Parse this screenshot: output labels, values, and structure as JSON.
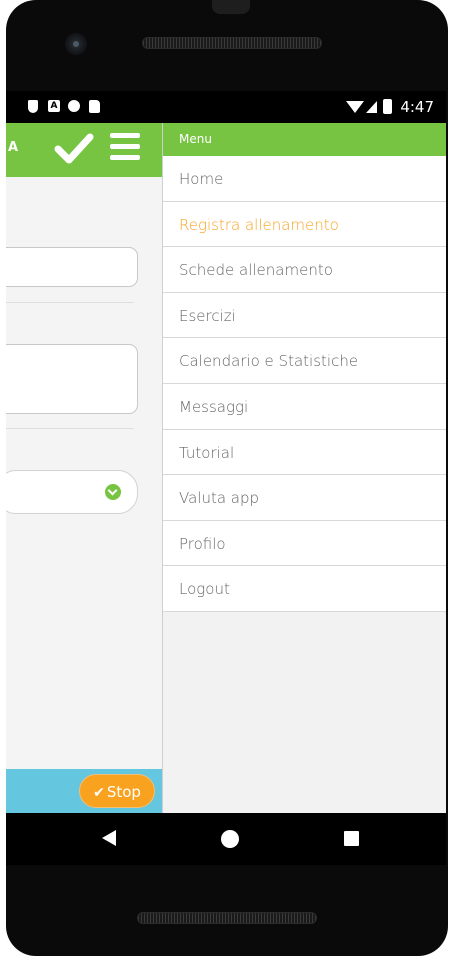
{
  "status_bar": {
    "left_icons": [
      "shield-icon",
      "a-icon",
      "record-icon",
      "sd-card-icon"
    ],
    "right_icons": [
      "wifi-icon",
      "signal-icon",
      "battery-charging-icon"
    ],
    "time": "4:47"
  },
  "app_bar": {
    "title_fragment": "A",
    "icons": [
      "checkmark-icon",
      "hamburger-menu-icon"
    ],
    "color": "#76c442"
  },
  "form": {
    "select_icon": "chevron-down-circle-icon"
  },
  "bottom_bar": {
    "stop_label": "Stop",
    "stop_icon": "checkmark-icon",
    "color": "#64c6df",
    "button_color": "#f8a21f"
  },
  "drawer": {
    "header": "Menu",
    "items": [
      {
        "label": "Home",
        "active": false
      },
      {
        "label": "Registra allenamento",
        "active": true
      },
      {
        "label": "Schede allenamento",
        "active": false
      },
      {
        "label": "Esercizi",
        "active": false
      },
      {
        "label": "Calendario e Statistiche",
        "active": false
      },
      {
        "label": "Messaggi",
        "active": false
      },
      {
        "label": "Tutorial",
        "active": false
      },
      {
        "label": "Valuta app",
        "active": false
      },
      {
        "label": "Profilo",
        "active": false
      },
      {
        "label": "Logout",
        "active": false
      }
    ],
    "active_color": "#f8a21f"
  },
  "nav_bar": {
    "icons": [
      "back-icon",
      "home-icon",
      "recent-apps-icon"
    ]
  }
}
